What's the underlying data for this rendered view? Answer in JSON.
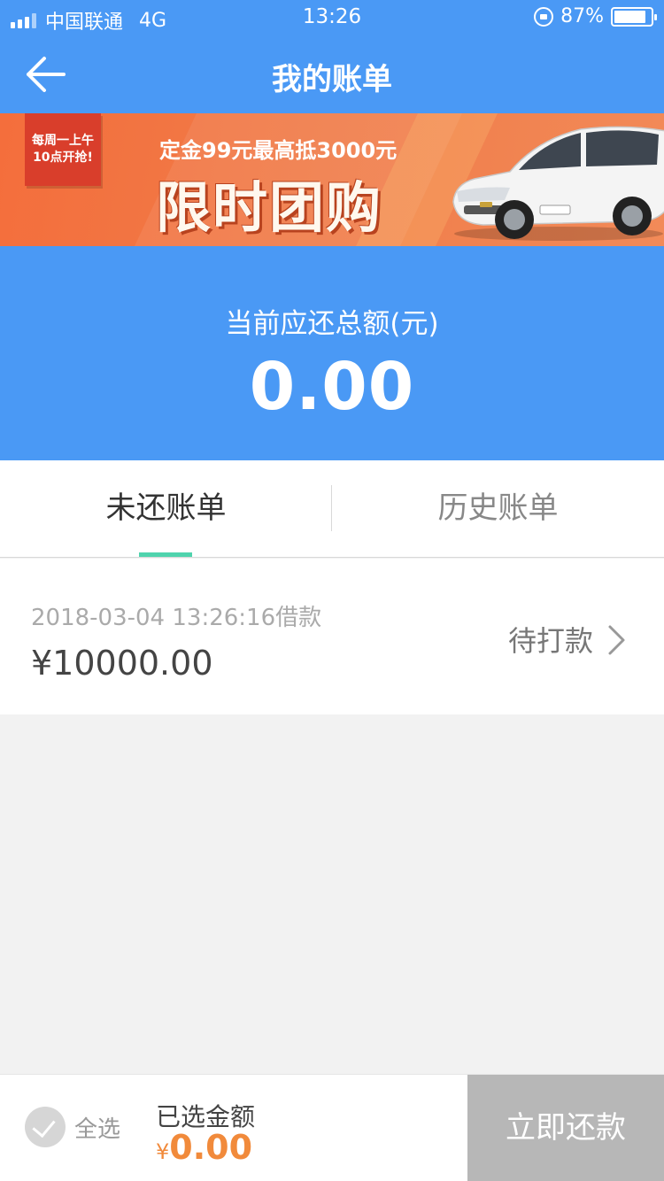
{
  "status_bar": {
    "carrier": "中国联通",
    "network": "4G",
    "time": "13:26",
    "battery_percent": "87%",
    "battery_level": 0.87
  },
  "nav": {
    "title": "我的账单",
    "back_icon": "arrow-left-icon"
  },
  "banner": {
    "tag_line1": "每周一上午",
    "tag_line2": "10点开抢!",
    "subtitle": "定金99元最高抵3000元",
    "title": "限时团购"
  },
  "summary": {
    "label": "当前应还总额(元)",
    "amount": "0.00"
  },
  "tabs": [
    {
      "label": "未还账单",
      "active": true
    },
    {
      "label": "历史账单",
      "active": false
    }
  ],
  "bills": [
    {
      "date": "2018-03-04 13:26:16借款",
      "amount": "¥10000.00",
      "status": "待打款"
    }
  ],
  "bottom_bar": {
    "select_all_label": "全选",
    "selected_title": "已选金额",
    "selected_currency": "¥",
    "selected_amount": "0.00",
    "repay_label": "立即还款"
  },
  "colors": {
    "primary_blue": "#4a99f5",
    "tab_indicator": "#4fd3ad",
    "amount_orange": "#f18a3b",
    "disabled_button": "#b7b7b7"
  }
}
